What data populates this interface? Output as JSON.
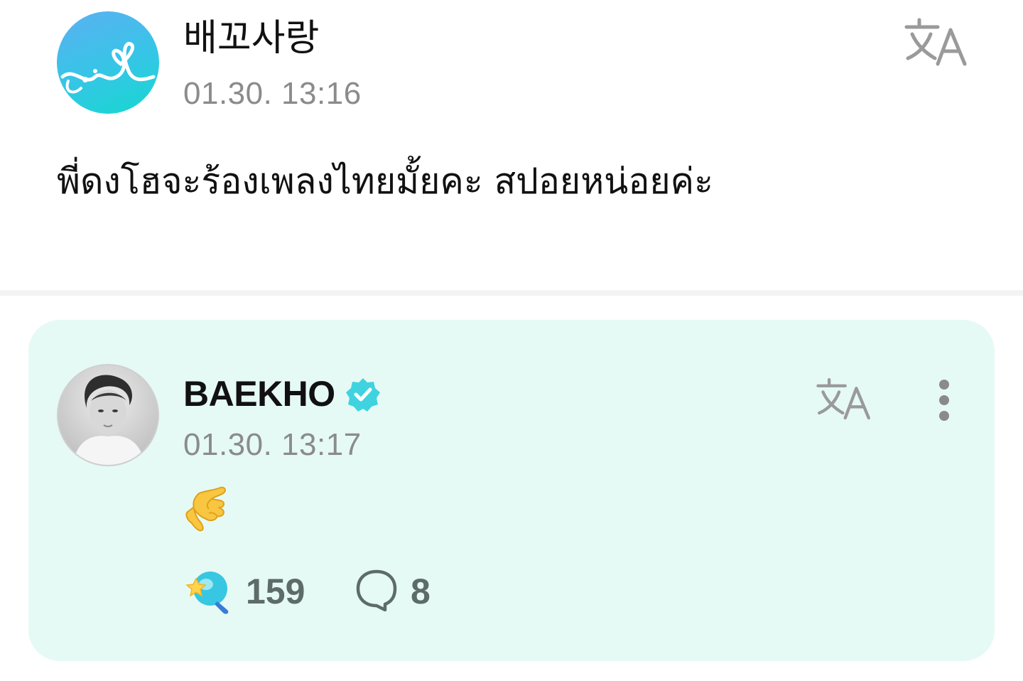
{
  "post": {
    "author": "배꼬사랑",
    "timestamp": "01.30. 13:16",
    "body": "พี่ดงโฮจะร้องเพลงไทยมั้ยคะ สปอยหน่อยค่ะ",
    "avatar_icon": "heart-string-logo",
    "translate_icon": "translate-icon"
  },
  "reply": {
    "author": "BAEKHO",
    "verified": true,
    "timestamp": "01.30. 13:17",
    "body_emoji": "call-me-hand-emoji",
    "likes": "159",
    "comments": "8",
    "translate_icon": "translate-icon",
    "more_icon": "more-vertical-icon"
  },
  "colors": {
    "card_background": "#e6faf5",
    "verified_badge": "#3fd3e0",
    "timestamp": "#8b8b8b",
    "count_text": "#5d6b6a",
    "icon_gray": "#8a8a8a"
  }
}
